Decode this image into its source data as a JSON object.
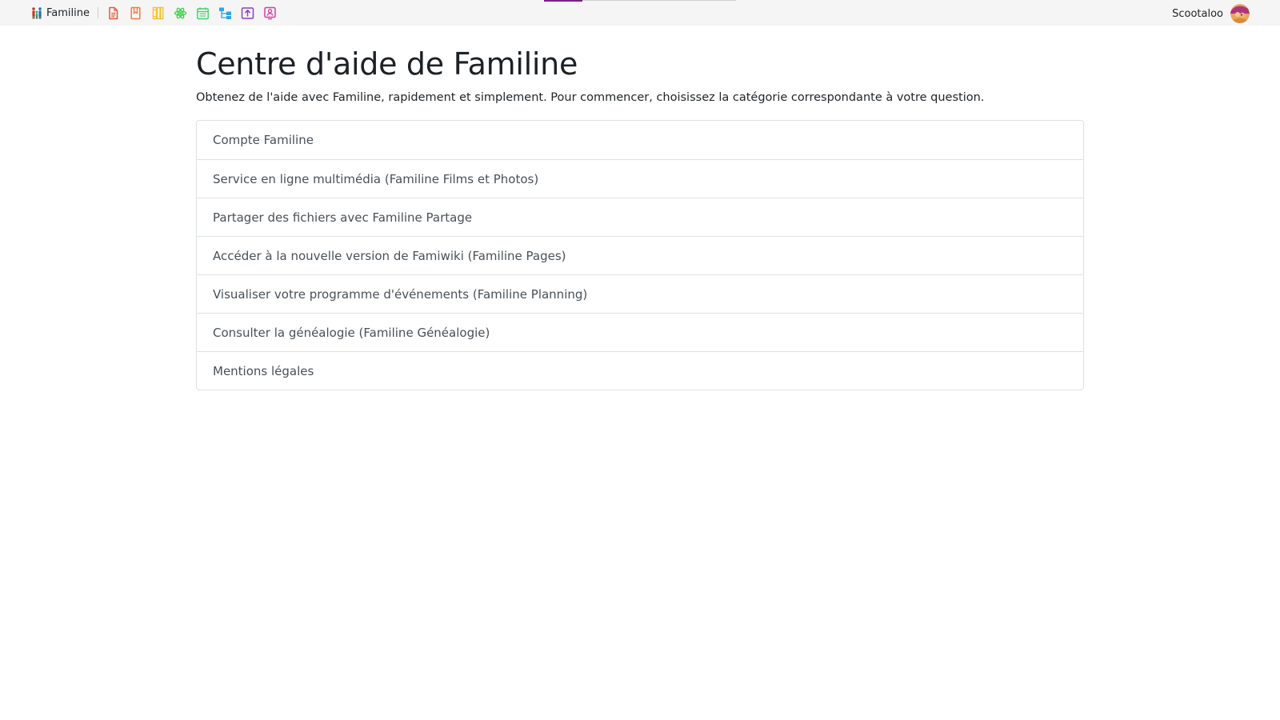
{
  "topbar": {
    "brand_label": "Familine",
    "apps": [
      {
        "name": "documents-app-icon",
        "color": "#e8573c"
      },
      {
        "name": "bookmark-app-icon",
        "color": "#f27a3a"
      },
      {
        "name": "library-app-icon",
        "color": "#f2c230"
      },
      {
        "name": "atom-app-icon",
        "color": "#3fd14a"
      },
      {
        "name": "calendar-app-icon",
        "color": "#3fd16e"
      },
      {
        "name": "tree-app-icon",
        "color": "#2ba6e8"
      },
      {
        "name": "upload-app-icon",
        "color": "#8a3fd1"
      },
      {
        "name": "profile-app-icon",
        "color": "#d13fa6"
      }
    ],
    "user_name": "Scootaloo",
    "accent_color": "#7a1f86"
  },
  "main": {
    "title": "Centre d'aide de Familine",
    "lead": "Obtenez de l'aide avec Familine, rapidement et simplement. Pour commencer, choisissez la catégorie correspondante à votre question.",
    "categories": [
      "Compte Familine",
      "Service en ligne multimédia (Familine Films et Photos)",
      "Partager des fichiers avec Familine Partage",
      "Accéder à la nouvelle version de Famiwiki (Familine Pages)",
      "Visualiser votre programme d'événements (Familine Planning)",
      "Consulter la généalogie (Familine Généalogie)",
      "Mentions légales"
    ]
  }
}
